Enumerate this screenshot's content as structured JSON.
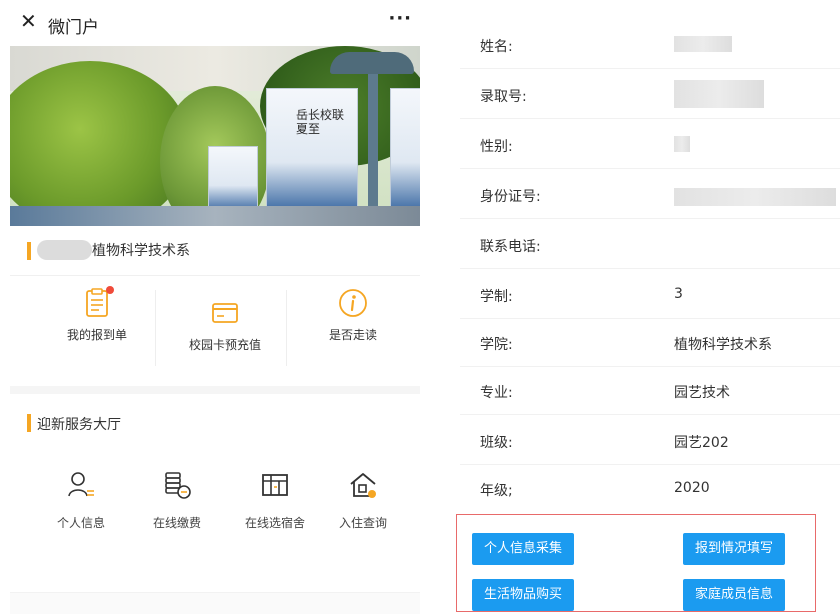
{
  "left": {
    "header": {
      "title": "微门户",
      "close_icon": "close-icon",
      "more_label": "···"
    },
    "banner": {
      "flag_text": "岳长校联 夏至",
      "carousel_count": 3,
      "active_index": 0
    },
    "department": {
      "name": "植物科学技术系"
    },
    "quick_actions": [
      {
        "label": "我的报到单",
        "icon": "clipboard-icon",
        "badge": true
      },
      {
        "label": "校园卡预充值",
        "icon": "card-icon",
        "badge": false
      },
      {
        "label": "是否走读",
        "icon": "info-icon",
        "badge": false
      }
    ],
    "service_hall": {
      "title": "迎新服务大厅",
      "items": [
        {
          "label": "个人信息",
          "icon": "user-icon"
        },
        {
          "label": "在线缴费",
          "icon": "coins-icon"
        },
        {
          "label": "在线选宿舍",
          "icon": "bed-icon"
        },
        {
          "label": "入住查询",
          "icon": "house-icon"
        }
      ]
    }
  },
  "right": {
    "fields": [
      {
        "label": "姓名:",
        "value": ""
      },
      {
        "label": "录取号:",
        "value": ""
      },
      {
        "label": "性别:",
        "value": ""
      },
      {
        "label": "身份证号:",
        "value": ""
      },
      {
        "label": "联系电话:",
        "value": ""
      },
      {
        "label": "学制:",
        "value": "3"
      },
      {
        "label": "学院:",
        "value": "植物科学技术系"
      },
      {
        "label": "专业:",
        "value": "园艺技术"
      },
      {
        "label": "班级:",
        "value": "园艺202"
      },
      {
        "label": "年级;",
        "value": "2020"
      }
    ],
    "actions": [
      {
        "label": "个人信息采集"
      },
      {
        "label": "报到情况填写"
      },
      {
        "label": "生活物品购买"
      },
      {
        "label": "家庭成员信息"
      }
    ]
  },
  "colors": {
    "accent": "#f5a623",
    "button": "#1b9bf0",
    "highlight_border": "#e86a6a",
    "badge": "#f04b3a"
  }
}
